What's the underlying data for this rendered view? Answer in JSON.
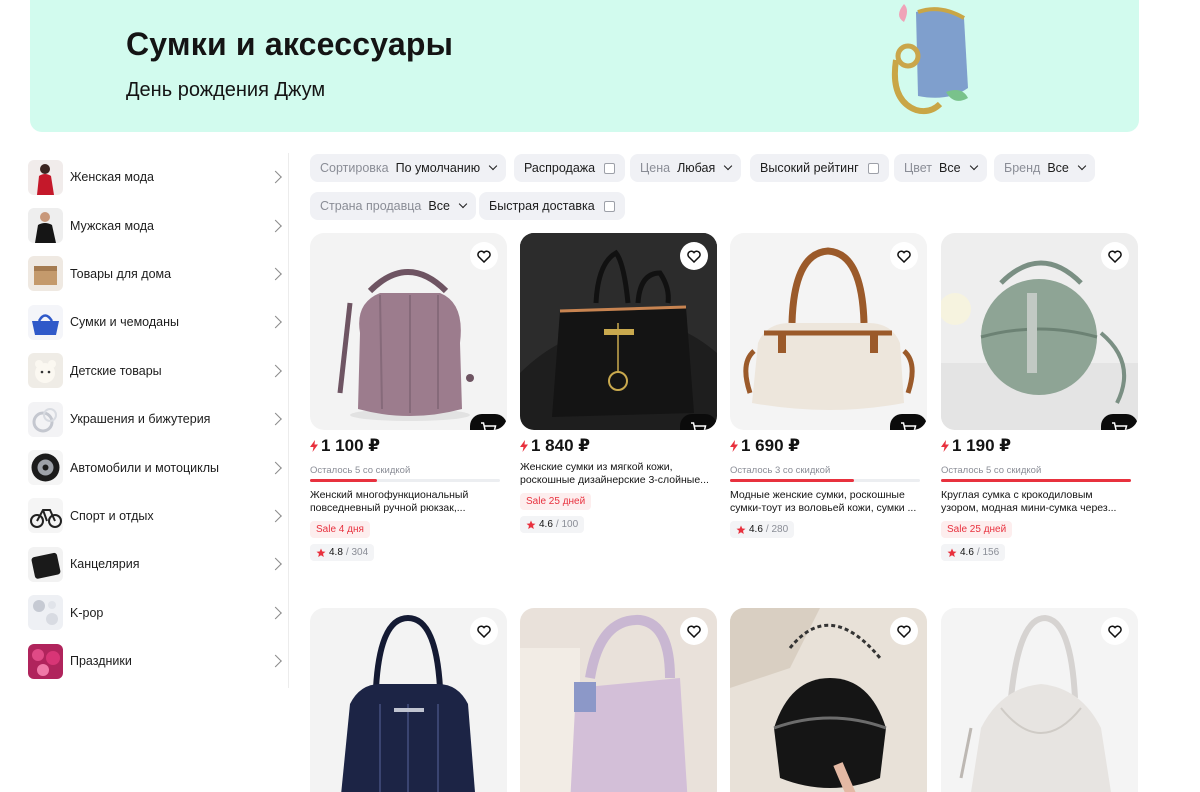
{
  "banner": {
    "title": "Сумки и аксессуары",
    "subtitle": "День рождения Джум"
  },
  "sidebar": {
    "items": [
      {
        "label": "Женская мода",
        "icon": "womens-fashion-thumb"
      },
      {
        "label": "Мужская мода",
        "icon": "mens-fashion-thumb"
      },
      {
        "label": "Товары для дома",
        "icon": "home-goods-thumb"
      },
      {
        "label": "Сумки и чемоданы",
        "icon": "bags-thumb"
      },
      {
        "label": "Детские товары",
        "icon": "kids-thumb"
      },
      {
        "label": "Украшения и бижутерия",
        "icon": "jewelry-thumb"
      },
      {
        "label": "Автомобили и мотоциклы",
        "icon": "auto-thumb"
      },
      {
        "label": "Спорт и отдых",
        "icon": "sport-thumb"
      },
      {
        "label": "Канцелярия",
        "icon": "stationery-thumb"
      },
      {
        "label": "K-pop",
        "icon": "kpop-thumb"
      },
      {
        "label": "Праздники",
        "icon": "holidays-thumb"
      }
    ]
  },
  "filters": {
    "sort": {
      "label": "Сортировка",
      "value": "По умолчанию"
    },
    "sale": {
      "label": "Распродажа"
    },
    "price": {
      "label": "Цена",
      "value": "Любая"
    },
    "high_rating": {
      "label": "Высокий рейтинг"
    },
    "color": {
      "label": "Цвет",
      "value": "Все"
    },
    "brand": {
      "label": "Бренд",
      "value": "Все"
    },
    "country": {
      "label": "Страна продавца",
      "value": "Все"
    },
    "fast_delivery": {
      "label": "Быстрая доставка"
    }
  },
  "products": [
    {
      "price": "1 100 ₽",
      "stock_note": "Осталось 5 со скидкой",
      "stock_fraction": 0.35,
      "name": "Женский многофункциональный повседневный ручной рюкзак,...",
      "sale": "Sale 4 дня",
      "rating": "4.8",
      "reviews": "/ 304"
    },
    {
      "price": "1 840 ₽",
      "stock_note": "",
      "name": "Женские сумки из мягкой кожи, роскошные дизайнерские 3-слойные...",
      "sale": "Sale 25 дней",
      "rating": "4.6",
      "reviews": "/ 100"
    },
    {
      "price": "1 690 ₽",
      "stock_note": "Осталось 3 со скидкой",
      "stock_fraction": 0.65,
      "name": "Модные женские сумки, роскошные сумки-тоут из воловьей кожи, сумки ...",
      "sale": "",
      "rating": "4.6",
      "reviews": "/ 280"
    },
    {
      "price": "1 190 ₽",
      "stock_note": "Осталось 5 со скидкой",
      "stock_fraction": 1.0,
      "name": "Круглая сумка с крокодиловым узором, модная мини-сумка через...",
      "sale": "Sale 25 дней",
      "rating": "4.6",
      "reviews": "/ 156"
    },
    {},
    {},
    {},
    {}
  ],
  "colors": {
    "banner_bg": "#d2fbee",
    "accent_red": "#e8313e",
    "chip_bg": "#f0f1f5"
  }
}
